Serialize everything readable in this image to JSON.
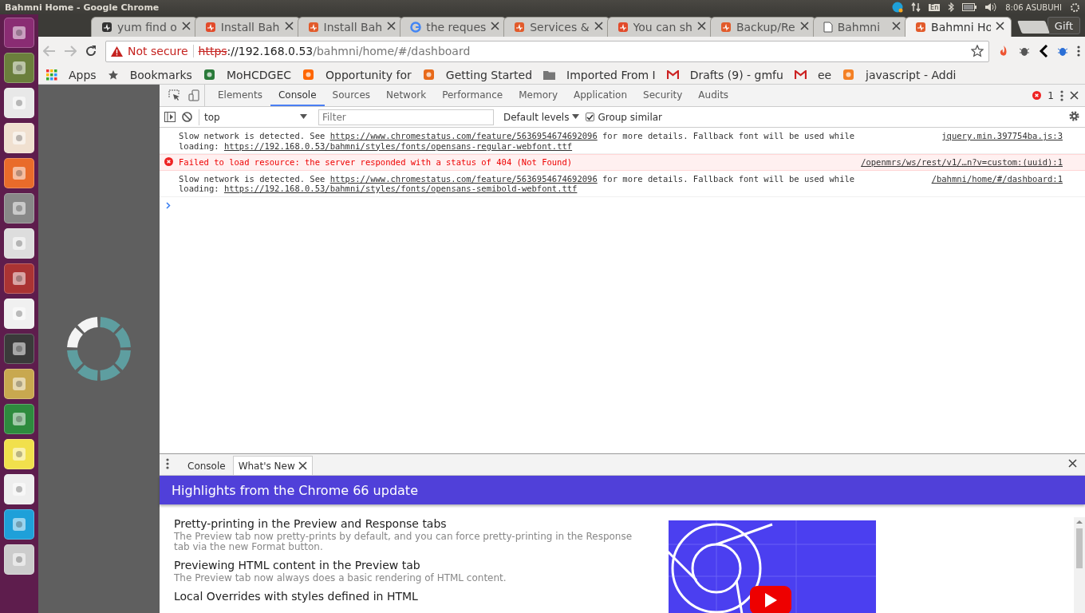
{
  "window": {
    "title": "Bahmni Home - Google Chrome"
  },
  "tray": {
    "keyboard": "En",
    "clock": "8:06 ASUBUHI"
  },
  "browser_tabs": [
    {
      "title": "yum find o",
      "selected": false
    },
    {
      "title": "Install Bah",
      "selected": false
    },
    {
      "title": "Install Bah",
      "selected": false
    },
    {
      "title": "the reques",
      "selected": false
    },
    {
      "title": "Services &",
      "selected": false
    },
    {
      "title": "You can sh",
      "selected": false
    },
    {
      "title": "Backup/Re",
      "selected": false
    },
    {
      "title": "Bahmni",
      "selected": false
    },
    {
      "title": "Bahmni Ho",
      "selected": true
    }
  ],
  "profile_button": "Gift",
  "address_bar": {
    "security": "Not secure",
    "scheme": "https",
    "host": "://192.168.0.53",
    "path": "/bahmni/home/#/dashboard"
  },
  "bookmarks": [
    "Apps",
    "Bookmarks",
    "MoHCDGEC",
    "Opportunity for",
    "Getting Started",
    "Imported From I",
    "Drafts (9) - gmfu",
    "ee",
    "javascript - Addi"
  ],
  "devtools": {
    "tabs": [
      {
        "label": "Elements",
        "selected": false
      },
      {
        "label": "Console",
        "selected": true
      },
      {
        "label": "Sources",
        "selected": false
      },
      {
        "label": "Network",
        "selected": false
      },
      {
        "label": "Performance",
        "selected": false
      },
      {
        "label": "Memory",
        "selected": false
      },
      {
        "label": "Application",
        "selected": false
      },
      {
        "label": "Security",
        "selected": false
      },
      {
        "label": "Audits",
        "selected": false
      }
    ],
    "error_count": "1",
    "console_toolbar": {
      "context": "top",
      "filter_placeholder": "Filter",
      "levels": "Default levels",
      "group_similar": {
        "label": "Group similar",
        "checked": true
      }
    },
    "messages": [
      {
        "kind": "log",
        "lines": [
          [
            {
              "text": "Slow network is detected. See "
            },
            {
              "link": "https://www.chromestatus.com/feature/5636954674692096"
            },
            {
              "text": " for more details. Fallback font will be used while"
            }
          ],
          [
            {
              "text": "loading: "
            },
            {
              "link": "https://192.168.0.53/bahmni/styles/fonts/opensans-regular-webfont.ttf"
            }
          ]
        ],
        "source": "jquery.min.397754ba.js:3"
      },
      {
        "kind": "error",
        "lines": [
          [
            {
              "text": "Failed to load resource: the server responded with a status of 404 (Not Found)"
            }
          ]
        ],
        "source": "/openmrs/ws/rest/v1/…n?v=custom:(uuid):1"
      },
      {
        "kind": "log",
        "lines": [
          [
            {
              "text": "Slow network is detected. See "
            },
            {
              "link": "https://www.chromestatus.com/feature/5636954674692096"
            },
            {
              "text": " for more details. Fallback font will be used while"
            }
          ],
          [
            {
              "text": "loading: "
            },
            {
              "link": "https://192.168.0.53/bahmni/styles/fonts/opensans-semibold-webfont.ttf"
            }
          ]
        ],
        "source": "/bahmni/home/#/dashboard:1"
      }
    ],
    "drawer": {
      "tabs": [
        {
          "label": "Console",
          "selected": false
        },
        {
          "label": "What's New",
          "selected": true
        }
      ],
      "header": "Highlights from the Chrome 66 update",
      "items": [
        {
          "title": "Pretty-printing in the Preview and Response tabs",
          "body": "The Preview tab now pretty-prints by default, and you can force pretty-printing in the Response tab via the new Format button."
        },
        {
          "title": "Previewing HTML content in the Preview tab",
          "body": "The Preview tab now always does a basic rendering of HTML content."
        },
        {
          "title": "Local Overrides with styles defined in HTML"
        }
      ]
    }
  }
}
